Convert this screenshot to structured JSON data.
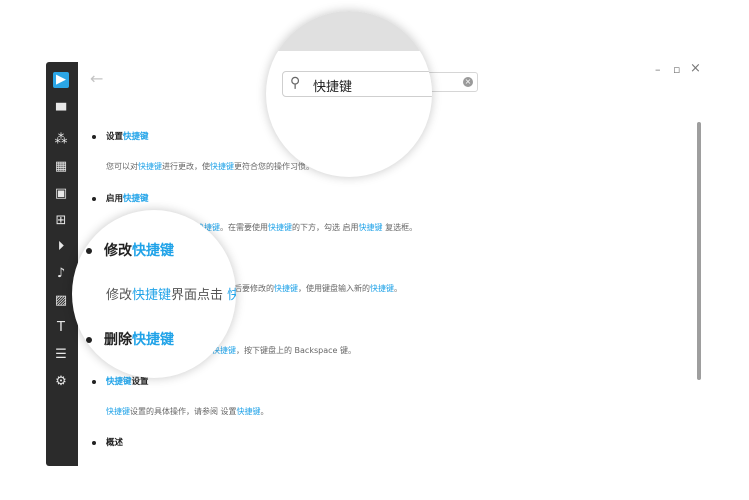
{
  "toolbar": {
    "search_value": "快捷键",
    "back_glyph": "←",
    "minimize_glyph": "–",
    "maximize_glyph": "▫",
    "close_glyph": "×"
  },
  "sidebar_icons": [
    "app-logo-icon",
    "text-title-icon",
    "effects-icon",
    "film-icon",
    "media-clip-icon",
    "add-clip-icon",
    "play-icon",
    "audio-icon",
    "image-icon",
    "text-icon",
    "list-icon",
    "gear-icon"
  ],
  "content": {
    "s1_title_pre": "设置",
    "s1_title_hl": "快捷键",
    "s1_para": {
      "a": "您可以对",
      "b": "快捷键",
      "c": "进行更改，使",
      "d": "快捷键",
      "e": "更符合您的操作习惯。"
    },
    "s2_title_pre": "启用",
    "s2_title_hl": "快捷键",
    "s2_para": {
      "b": "快捷键",
      "c": "。在需要使用",
      "d": "快捷键",
      "e": "的下方，勾选 启用",
      "f": "快捷键",
      "g": " 复选框。"
    },
    "s3_para": {
      "a": "后要修改的",
      "b": "快捷键",
      "c": "，使用键盘输入新的",
      "d": "快捷键",
      "e": "。"
    },
    "s4_para": {
      "b": "快捷键",
      "c": "，按下键盘上的 Backspace 键。"
    },
    "s5_title_hl": "快捷键",
    "s5_title_post": "设置",
    "s5_para": {
      "a": "快捷键",
      "b": "设置的具体操作，请参阅 设置",
      "c": "快捷键",
      "d": "。"
    },
    "s6_title": "概述"
  },
  "magnifier_bottom": {
    "item1_pre": "修改",
    "item1_hl": "快捷键",
    "para_pre": "修改",
    "para_hl": "快捷键",
    "para_post": "界面点击 ",
    "para_tail": "快",
    "item2_pre": "删除",
    "item2_hl": "快捷键"
  }
}
